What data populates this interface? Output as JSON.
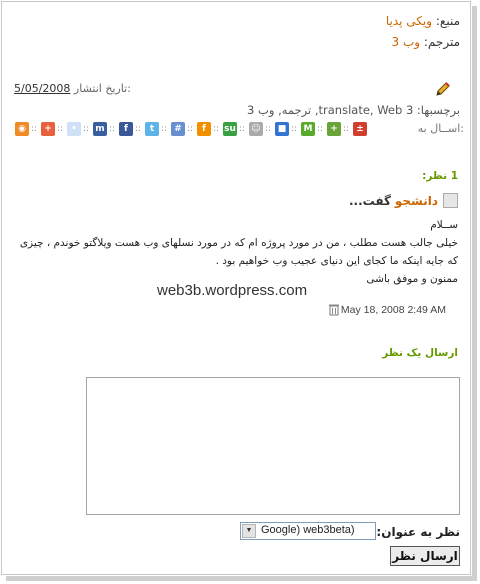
{
  "post": {
    "source_label": "منبع:",
    "source_value": "ویکی پدیا",
    "translator_label": "مترجم:",
    "translator_value": "وب 3",
    "publish_label": "تاریخ انتشار:",
    "publish_date": "5/05/2008",
    "tags_label": "برچسبها:",
    "tags": "translate, Web 3, ترجمه, وب 3",
    "share_label": "اســال به:"
  },
  "share_icons": [
    {
      "name": "share-rss-icon",
      "color": "#f08a24",
      "glyph": "◉"
    },
    {
      "name": "share-plus-icon",
      "color": "#e8613d",
      "glyph": "+"
    },
    {
      "name": "share-reddit-icon",
      "color": "#cfe0f7",
      "glyph": "•"
    },
    {
      "name": "share-myspace-icon",
      "color": "#3a5f9f",
      "glyph": "m"
    },
    {
      "name": "share-facebook-icon",
      "color": "#3b5998",
      "glyph": "f"
    },
    {
      "name": "share-twitter-icon",
      "color": "#5bb3e8",
      "glyph": "t"
    },
    {
      "name": "share-furl-icon",
      "color": "#6a8fd1",
      "glyph": "#"
    },
    {
      "name": "share-fark-icon",
      "color": "#f29100",
      "glyph": "f"
    },
    {
      "name": "share-stumbleupon-icon",
      "color": "#3aa143",
      "glyph": "su"
    },
    {
      "name": "share-people-icon",
      "color": "#aaaaaa",
      "glyph": "☺"
    },
    {
      "name": "share-delicious-icon",
      "color": "#3274d1",
      "glyph": "■"
    },
    {
      "name": "share-mixx-icon",
      "color": "#5aaa2c",
      "glyph": "M"
    },
    {
      "name": "share-add-icon",
      "color": "#6aa338",
      "glyph": "+"
    },
    {
      "name": "share-digg-icon",
      "color": "#d03e2f",
      "glyph": "±"
    }
  ],
  "comments": {
    "count_label": "1 نظر:",
    "author": "دانشجو",
    "said": "گفت...",
    "lines": [
      "ســلام",
      "خیلی جالب هست مطلب ، من در مورد پروژه ام که در مورد نسلهای وب هست ویلاگتو خوندم ، چیزی",
      "که جایه اینکه ما کجای این دنیای عجیب وب خواهیم بود .",
      "ممنون و موفق باشی"
    ],
    "watermark": "web3b.wordpress.com",
    "date": "May 18, 2008 2:49 AM"
  },
  "form": {
    "post_label": "ارسال یک نظر",
    "subject_label": "نظر به عنوان:",
    "subject_value": "Google) web3beta)",
    "submit_label": "ارسال نظر"
  }
}
